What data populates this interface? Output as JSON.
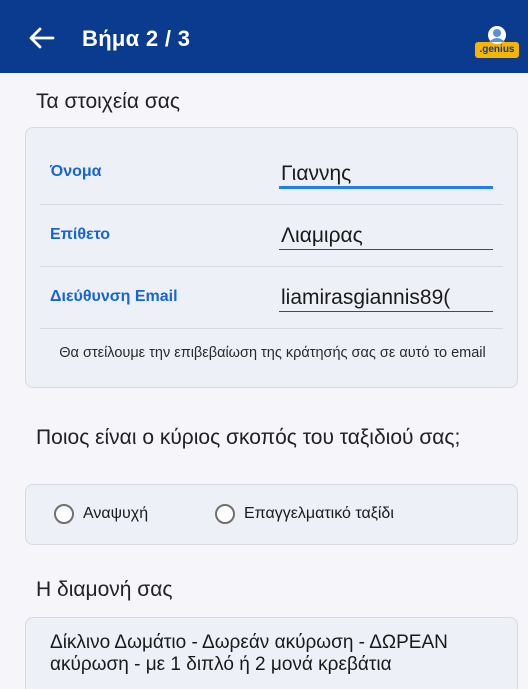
{
  "header": {
    "back_icon": "arrow-left-icon",
    "title": "Βήμα 2 / 3",
    "logo_text": ".genius",
    "logo_icon": "genius-user-icon",
    "colors": {
      "appbar": "#0a3b8f",
      "logo_yellow": "#f7b500",
      "accent": "#1565d8"
    }
  },
  "details": {
    "heading": "Τα στοιχεία σας",
    "first_name": {
      "label": "Όνομα",
      "value": "Γιαννης"
    },
    "last_name": {
      "label": "Επίθετο",
      "value": "Λιαμιρας"
    },
    "email": {
      "label": "Διεύθυνση Email",
      "value": "liamirasgiannis89("
    },
    "note": "Θα στείλουμε την επιβεβαίωση της κράτησής σας σε αυτό το email"
  },
  "purpose": {
    "heading": "Ποιος είναι ο κύριος σκοπός του ταξιδιού σας;",
    "options": [
      {
        "label": "Αναψυχή",
        "selected": false
      },
      {
        "label": "Επαγγελματικό ταξίδι",
        "selected": false
      }
    ]
  },
  "stay": {
    "heading": "Η διαμονή σας",
    "room_description": "Δίκλινο Δωμάτιο - Δωρεάν ακύρωση - ΔΩΡΕΑΝ ακύρωση - με 1 διπλό ή 2 μονά κρεβάτια"
  }
}
